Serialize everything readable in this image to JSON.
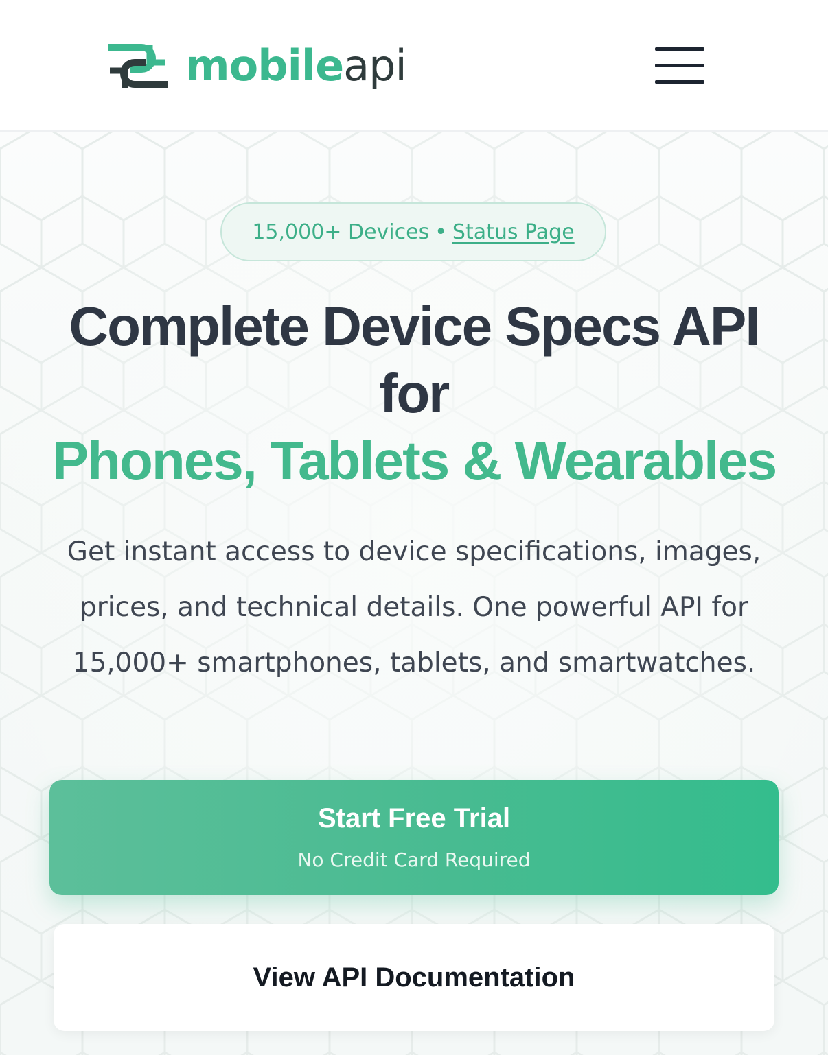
{
  "brand": {
    "name_strong": "mobile",
    "name_light": "api",
    "accent_color": "#3cb88f",
    "dark_color": "#2f3b3c"
  },
  "header": {
    "menu_icon": "hamburger-menu-icon"
  },
  "hero": {
    "badge": {
      "devices": "15,000+ Devices",
      "separator": "•",
      "status_link": "Status Page"
    },
    "title_line1": "Complete Device Specs API",
    "title_line2": "for",
    "title_accent": "Phones, Tablets & Wearables",
    "subtitle": "Get instant access to device specifications, images, prices, and technical details. One powerful API for 15,000+ smartphones, tablets, and smartwatches.",
    "primary_cta": {
      "label": "Start Free Trial",
      "sublabel": "No Credit Card Required"
    },
    "secondary_cta": {
      "label": "View API Documentation"
    }
  }
}
